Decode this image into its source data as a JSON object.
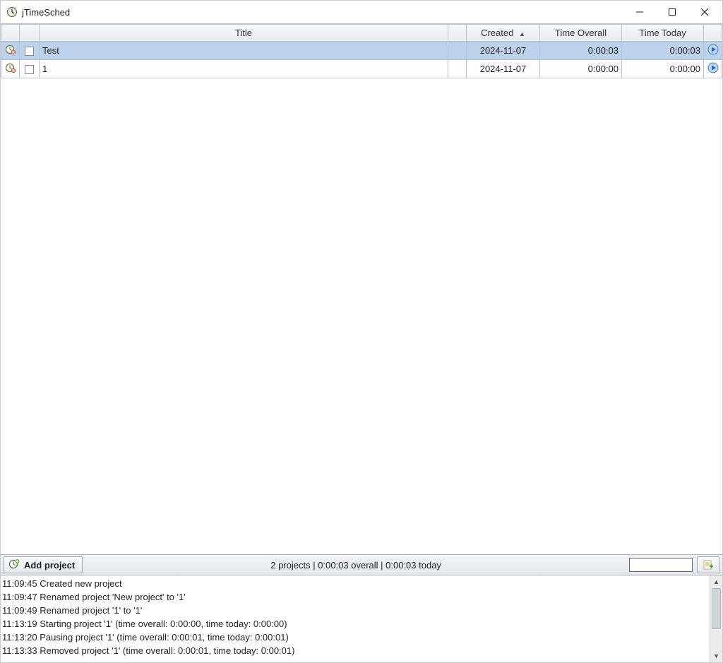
{
  "window": {
    "title": "jTimeSched"
  },
  "columns": {
    "del": "",
    "check": "",
    "title": "Title",
    "color": "",
    "created": "Created",
    "overall": "Time Overall",
    "today": "Time Today",
    "play": ""
  },
  "sort": {
    "column": "created",
    "dir": "asc",
    "indicator": "▲"
  },
  "rows": [
    {
      "title": "Test",
      "created": "2024-11-07",
      "overall": "0:00:03",
      "today": "0:00:03",
      "selected": true
    },
    {
      "title": "1",
      "created": "2024-11-07",
      "overall": "0:00:00",
      "today": "0:00:00",
      "selected": false
    }
  ],
  "toolbar": {
    "add_label": "Add project",
    "status": "2 projects | 0:00:03 overall | 0:00:03 today",
    "search_value": ""
  },
  "log": [
    "11:09:45 Created new project",
    "11:09:47 Renamed project 'New project' to '1'",
    "11:09:49 Renamed project '1' to '1'",
    "11:13:19 Starting project '1' (time overall: 0:00:00, time today: 0:00:00)",
    "11:13:20 Pausing project '1' (time overall: 0:00:01, time today: 0:00:01)",
    "11:13:33 Removed project '1' (time overall: 0:00:01, time today: 0:00:01)"
  ]
}
